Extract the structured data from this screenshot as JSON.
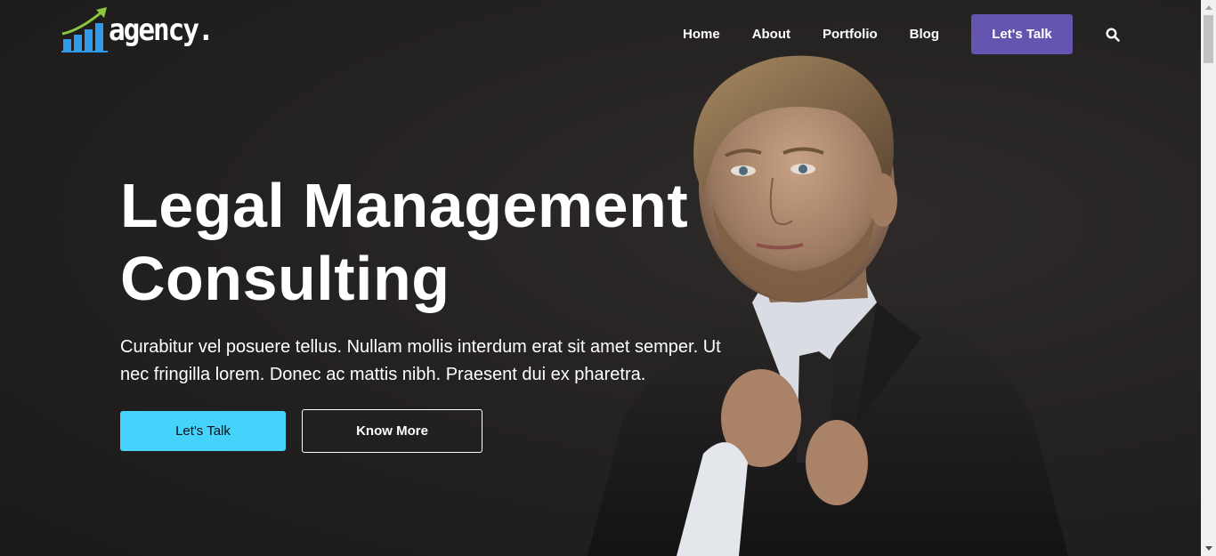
{
  "header": {
    "logo_text": "agency.",
    "logo_icon": "bar-chart-growth-icon",
    "nav": [
      {
        "label": "Home"
      },
      {
        "label": "About"
      },
      {
        "label": "Portfolio"
      },
      {
        "label": "Blog"
      }
    ],
    "cta_label": "Let's Talk",
    "search_icon": "search-icon"
  },
  "hero": {
    "title_line1": "Legal Management",
    "title_line2": "Consulting",
    "description": "Curabitur vel posuere tellus. Nullam mollis interdum erat sit amet semper. Ut nec fringilla lorem. Donec ac mattis nibh. Praesent dui ex pharetra.",
    "primary_button": "Let's Talk",
    "secondary_button": "Know More"
  },
  "colors": {
    "background": "#232120",
    "accent_purple": "#6655b0",
    "accent_cyan": "#45d2fb",
    "logo_green": "#8cc63f",
    "logo_blue": "#2f9bea"
  }
}
